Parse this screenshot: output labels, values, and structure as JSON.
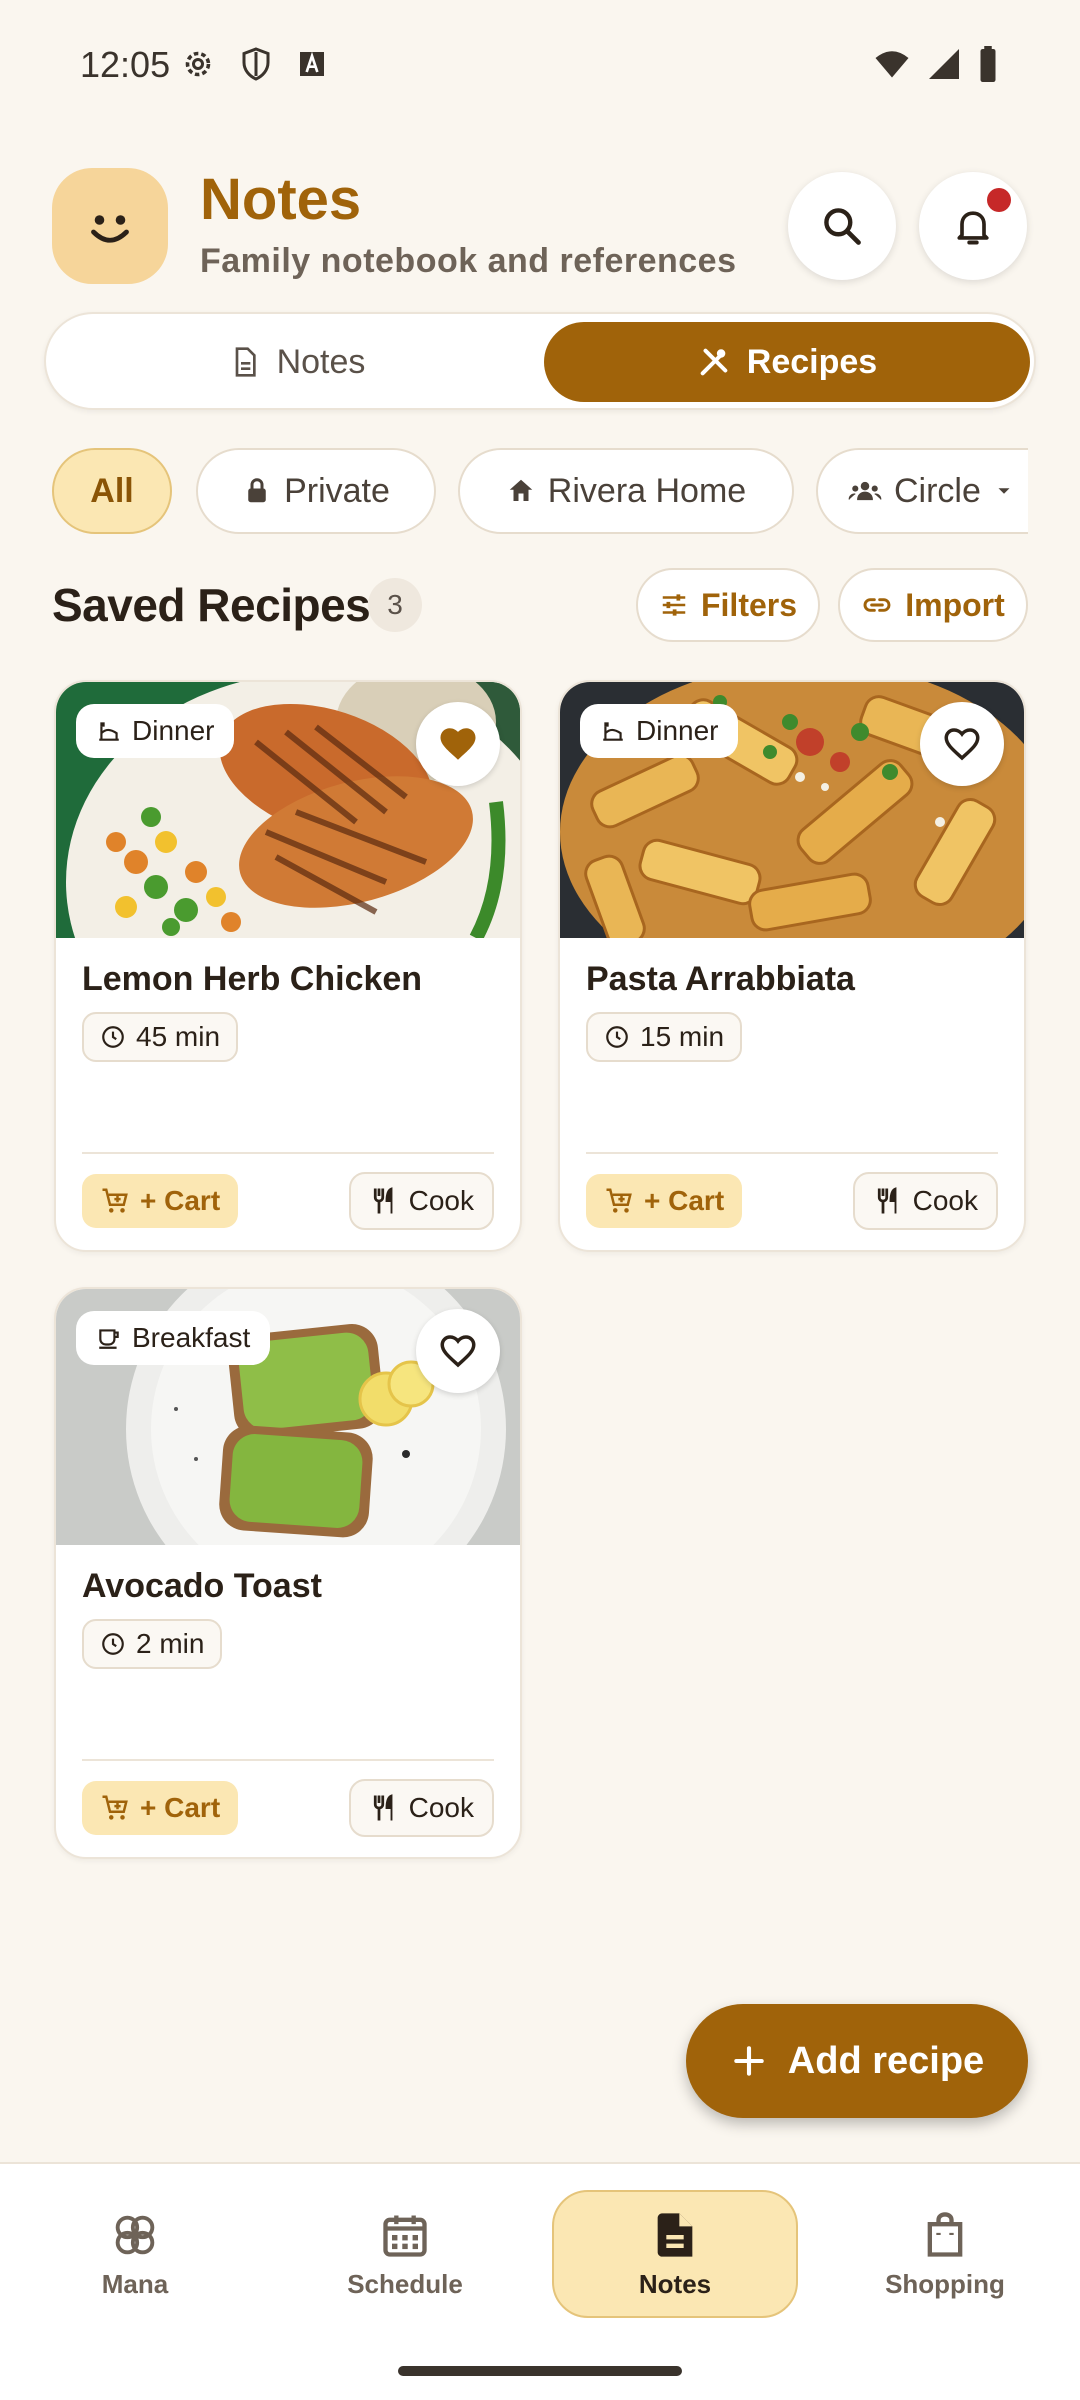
{
  "status_bar": {
    "time": "12:05"
  },
  "header": {
    "title": "Notes",
    "subtitle": "Family notebook and references"
  },
  "segment": {
    "notes_label": "Notes",
    "recipes_label": "Recipes",
    "selected": "Recipes"
  },
  "filters": {
    "chips": [
      {
        "label": "All",
        "selected": true
      },
      {
        "label": "Private",
        "selected": false
      },
      {
        "label": "Rivera Home",
        "selected": false
      },
      {
        "label": "Circle",
        "selected": false
      }
    ]
  },
  "section": {
    "title": "Saved Recipes",
    "count": "3",
    "filters_label": "Filters",
    "import_label": "Import"
  },
  "recipes": [
    {
      "name": "Lemon Herb Chicken",
      "meal": "Dinner",
      "time": "45 min",
      "favorite": true,
      "cart_label": "+ Cart",
      "cook_label": "Cook"
    },
    {
      "name": "Pasta Arrabbiata",
      "meal": "Dinner",
      "time": "15 min",
      "favorite": false,
      "cart_label": "+ Cart",
      "cook_label": "Cook"
    },
    {
      "name": "Avocado Toast",
      "meal": "Breakfast",
      "time": "2 min",
      "favorite": false,
      "cart_label": "+ Cart",
      "cook_label": "Cook"
    }
  ],
  "fab": {
    "label": "Add recipe"
  },
  "bottom_nav": {
    "items": [
      {
        "label": "Mana",
        "icon": "flower-icon"
      },
      {
        "label": "Schedule",
        "icon": "calendar-icon"
      },
      {
        "label": "Notes",
        "icon": "note-icon",
        "active": true
      },
      {
        "label": "Shopping",
        "icon": "bag-icon"
      }
    ]
  },
  "colors": {
    "accent": "#a0630a",
    "accent_soft": "#fbe7b3",
    "background": "#faf6ef",
    "notification": "#c62828"
  }
}
